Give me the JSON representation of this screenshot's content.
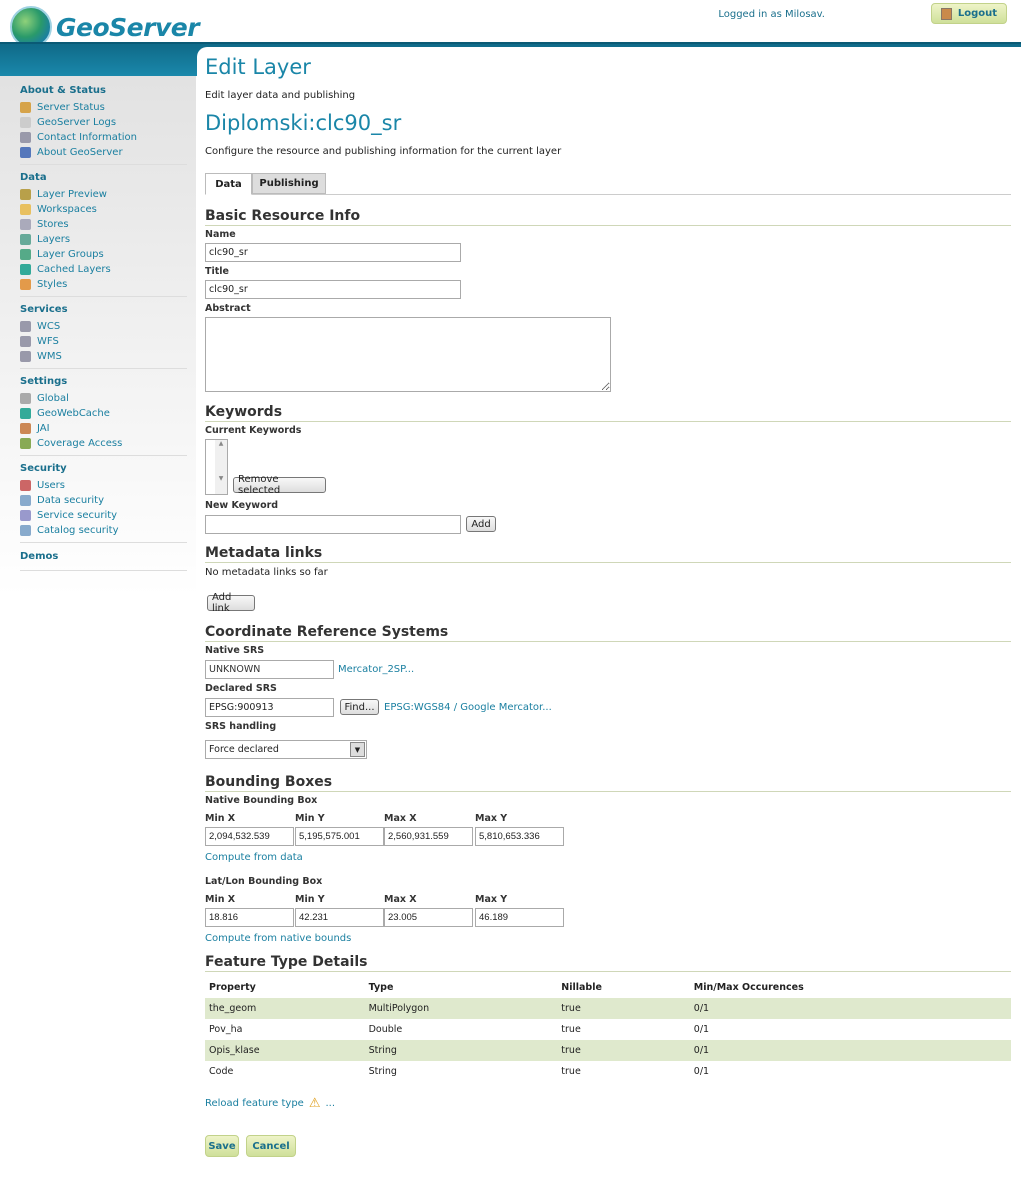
{
  "header": {
    "brand": "GeoServer",
    "logged_in": "Logged in as Milosav.",
    "logout": "Logout"
  },
  "sidebar": [
    {
      "title": "About & Status",
      "items": [
        {
          "label": "Server Status",
          "icon": "server-status-icon",
          "color": "#d6a34a"
        },
        {
          "label": "GeoServer Logs",
          "icon": "logs-icon",
          "color": "#ccc"
        },
        {
          "label": "Contact Information",
          "icon": "contact-icon",
          "color": "#99a"
        },
        {
          "label": "About GeoServer",
          "icon": "help-icon",
          "color": "#5577bb"
        }
      ]
    },
    {
      "title": "Data",
      "items": [
        {
          "label": "Layer Preview",
          "icon": "layer-preview-icon",
          "color": "#b8a04a"
        },
        {
          "label": "Workspaces",
          "icon": "folder-icon",
          "color": "#e8c060"
        },
        {
          "label": "Stores",
          "icon": "database-icon",
          "color": "#aab"
        },
        {
          "label": "Layers",
          "icon": "layers-icon",
          "color": "#6a9"
        },
        {
          "label": "Layer Groups",
          "icon": "layer-groups-icon",
          "color": "#5a8"
        },
        {
          "label": "Cached Layers",
          "icon": "globe-icon",
          "color": "#3a9"
        },
        {
          "label": "Styles",
          "icon": "palette-icon",
          "color": "#e39a4a"
        }
      ]
    },
    {
      "title": "Services",
      "items": [
        {
          "label": "WCS",
          "icon": "service-icon",
          "color": "#99a"
        },
        {
          "label": "WFS",
          "icon": "service-icon",
          "color": "#99a"
        },
        {
          "label": "WMS",
          "icon": "service-icon",
          "color": "#99a"
        }
      ]
    },
    {
      "title": "Settings",
      "items": [
        {
          "label": "Global",
          "icon": "server-icon",
          "color": "#aaa"
        },
        {
          "label": "GeoWebCache",
          "icon": "globe-icon",
          "color": "#3a9"
        },
        {
          "label": "JAI",
          "icon": "jai-icon",
          "color": "#c85"
        },
        {
          "label": "Coverage Access",
          "icon": "coverage-icon",
          "color": "#8a5"
        }
      ]
    },
    {
      "title": "Security",
      "items": [
        {
          "label": "Users",
          "icon": "user-icon",
          "color": "#c66"
        },
        {
          "label": "Data security",
          "icon": "data-security-icon",
          "color": "#8ac"
        },
        {
          "label": "Service security",
          "icon": "service-security-icon",
          "color": "#99c"
        },
        {
          "label": "Catalog security",
          "icon": "catalog-security-icon",
          "color": "#8ac"
        }
      ]
    },
    {
      "title": "Demos",
      "items": []
    }
  ],
  "page": {
    "title": "Edit Layer",
    "subtitle": "Edit layer data and publishing",
    "layer": "Diplomski:clc90_sr",
    "description": "Configure the resource and publishing information for the current layer",
    "tabs": [
      "Data",
      "Publishing"
    ]
  },
  "basic": {
    "heading": "Basic Resource Info",
    "name_label": "Name",
    "name": "clc90_sr",
    "title_label": "Title",
    "title": "clc90_sr",
    "abstract_label": "Abstract",
    "abstract": ""
  },
  "keywords": {
    "heading": "Keywords",
    "current_label": "Current Keywords",
    "remove": "Remove selected",
    "new_label": "New Keyword",
    "new_value": "",
    "add": "Add"
  },
  "metadata": {
    "heading": "Metadata links",
    "empty": "No metadata links so far",
    "add": "Add link"
  },
  "crs": {
    "heading": "Coordinate Reference Systems",
    "native_label": "Native SRS",
    "native": "UNKNOWN",
    "native_link": "Mercator_2SP...",
    "declared_label": "Declared SRS",
    "declared": "EPSG:900913",
    "find": "Find...",
    "declared_link": "EPSG:WGS84 / Google Mercator...",
    "handling_label": "SRS handling",
    "handling": "Force declared"
  },
  "bbox": {
    "heading": "Bounding Boxes",
    "native_label": "Native Bounding Box",
    "cols": [
      "Min X",
      "Min Y",
      "Max X",
      "Max Y"
    ],
    "native": [
      "2,094,532.539",
      "5,195,575.001",
      "2,560,931.559",
      "5,810,653.336"
    ],
    "compute_native": "Compute from data",
    "latlon_label": "Lat/Lon Bounding Box",
    "latlon": [
      "18.816",
      "42.231",
      "23.005",
      "46.189"
    ],
    "compute_latlon": "Compute from native bounds"
  },
  "features": {
    "heading": "Feature Type Details",
    "columns": [
      "Property",
      "Type",
      "Nillable",
      "Min/Max Occurences"
    ],
    "rows": [
      [
        "the_geom",
        "MultiPolygon",
        "true",
        "0/1"
      ],
      [
        "Pov_ha",
        "Double",
        "true",
        "0/1"
      ],
      [
        "Opis_klase",
        "String",
        "true",
        "0/1"
      ],
      [
        "Code",
        "String",
        "true",
        "0/1"
      ]
    ],
    "reload": "Reload feature type",
    "ellipsis": "..."
  },
  "actions": {
    "save": "Save",
    "cancel": "Cancel"
  }
}
